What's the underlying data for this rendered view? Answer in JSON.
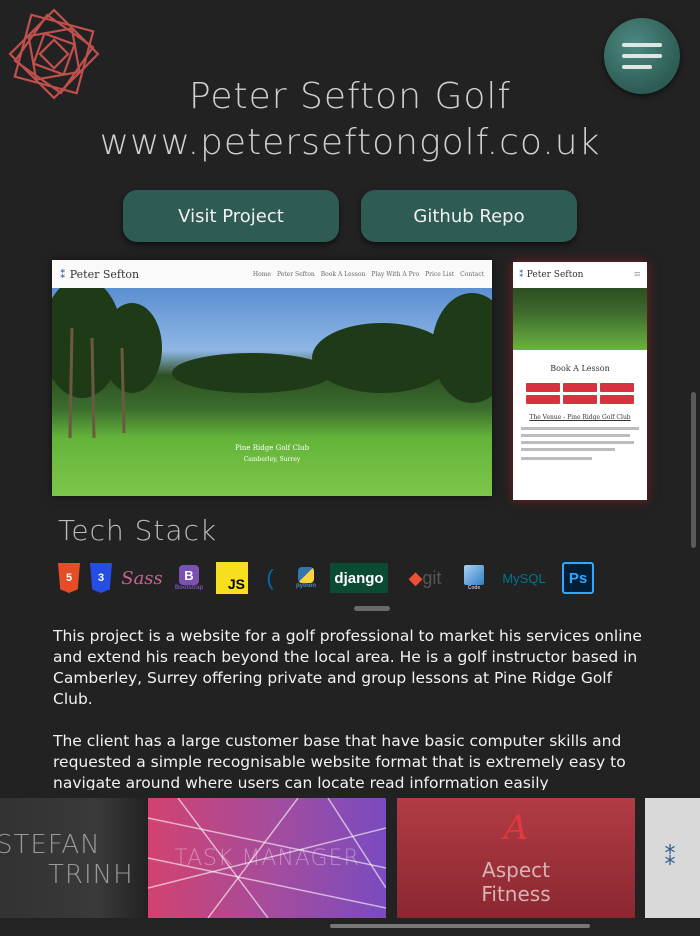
{
  "header": {
    "title": "Peter Sefton Golf",
    "subtitle": "www.peterseftongolf.co.uk",
    "logo_icon": "geometric-logo-icon",
    "menu_icon": "hamburger-menu-icon",
    "accent_color": "#2f5b55"
  },
  "buttons": {
    "visit": "Visit Project",
    "github": "Github Repo"
  },
  "preview": {
    "desktop": {
      "brand": "Peter Sefton",
      "nav_links": [
        "Home",
        "Peter Sefton",
        "Book A Lesson",
        "Play With A Pro",
        "Price List",
        "Contact"
      ],
      "caption_line1": "Pine Ridge Golf Club",
      "caption_line2": "Camberley, Surrey"
    },
    "mobile": {
      "brand": "Peter Sefton",
      "heading": "Book A Lesson",
      "venue": "The Venue - Pine Ridge Golf Club"
    }
  },
  "tech_stack": {
    "title": "Tech Stack",
    "icons": [
      "html5-icon",
      "css3-icon",
      "sass-icon",
      "bootstrap-icon",
      "javascript-icon",
      "jquery-icon",
      "python-icon",
      "django-icon",
      "git-icon",
      "vscode-icon",
      "mysql-icon",
      "photoshop-icon"
    ],
    "labels": {
      "html5": "5",
      "css3": "3",
      "sass": "Sass",
      "bootstrap": "B",
      "bootstrap_text": "Bootstrap",
      "js": "JS",
      "jquery": "(",
      "python_text": "python",
      "django": "django",
      "git": "git",
      "vscode_text": "Code",
      "mysql": "MySQL",
      "ps": "Ps"
    }
  },
  "description": {
    "p1": "This project is a website for a golf professional to market his services online and extend his reach beyond the local area. He is a golf instructor based in Camberley, Surrey offering private and group lessons at Pine Ridge Golf Club.",
    "p2": "The client has a large customer base that have basic computer skills and requested a simple recognisable website format that is extremely easy to navigate around where users can locate read information easily"
  },
  "carousel": {
    "stefan_line1": "STEFAN",
    "stefan_line2": "TRINH",
    "task_manager": "TASK MANAGER",
    "aspect_mark": "A",
    "aspect_line1": "Aspect",
    "aspect_line2": "Fitness"
  }
}
